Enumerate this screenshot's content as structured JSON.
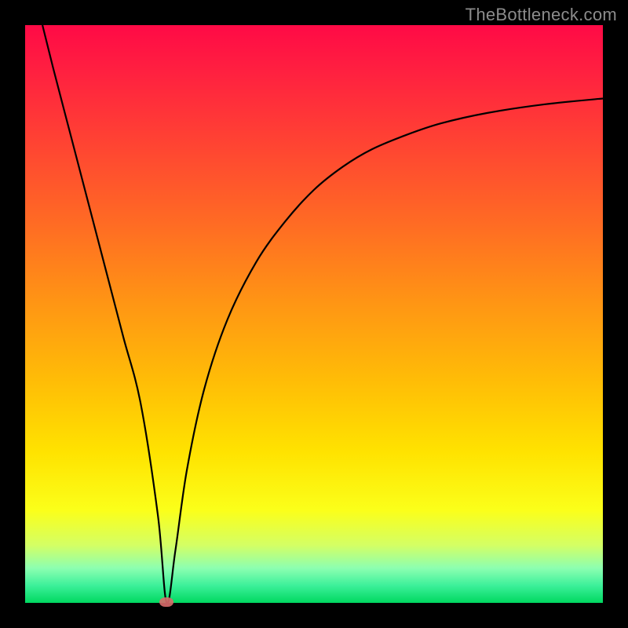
{
  "watermark": "TheBottleneck.com",
  "chart_data": {
    "type": "line",
    "title": "",
    "xlabel": "",
    "ylabel": "",
    "xlim": [
      0,
      100
    ],
    "ylim": [
      0,
      100
    ],
    "grid": false,
    "background_gradient_stops": [
      {
        "pos": 0,
        "color": "#ff0a46"
      },
      {
        "pos": 8,
        "color": "#ff2040"
      },
      {
        "pos": 20,
        "color": "#ff4233"
      },
      {
        "pos": 34,
        "color": "#ff6a24"
      },
      {
        "pos": 48,
        "color": "#ff9514"
      },
      {
        "pos": 62,
        "color": "#ffbe06"
      },
      {
        "pos": 74,
        "color": "#ffe300"
      },
      {
        "pos": 84,
        "color": "#fbff1a"
      },
      {
        "pos": 90,
        "color": "#d4ff64"
      },
      {
        "pos": 94,
        "color": "#8cffb1"
      },
      {
        "pos": 97,
        "color": "#3cf09a"
      },
      {
        "pos": 100,
        "color": "#00d860"
      }
    ],
    "series": [
      {
        "name": "bottleneck-curve",
        "color": "#000000",
        "x": [
          3,
          5,
          8,
          11,
          14,
          17,
          20,
          23,
          24.5,
          26,
          28,
          31,
          35,
          40,
          45,
          50,
          55,
          60,
          66,
          72,
          80,
          90,
          100
        ],
        "y": [
          100,
          92,
          80.5,
          69,
          57.5,
          46,
          34.5,
          15,
          0,
          9,
          23,
          37,
          49,
          59,
          66,
          71.5,
          75.5,
          78.5,
          81,
          83,
          84.8,
          86.3,
          87.3
        ]
      }
    ],
    "marker": {
      "x": 24.5,
      "y": 0,
      "color": "#d86b6c"
    }
  }
}
